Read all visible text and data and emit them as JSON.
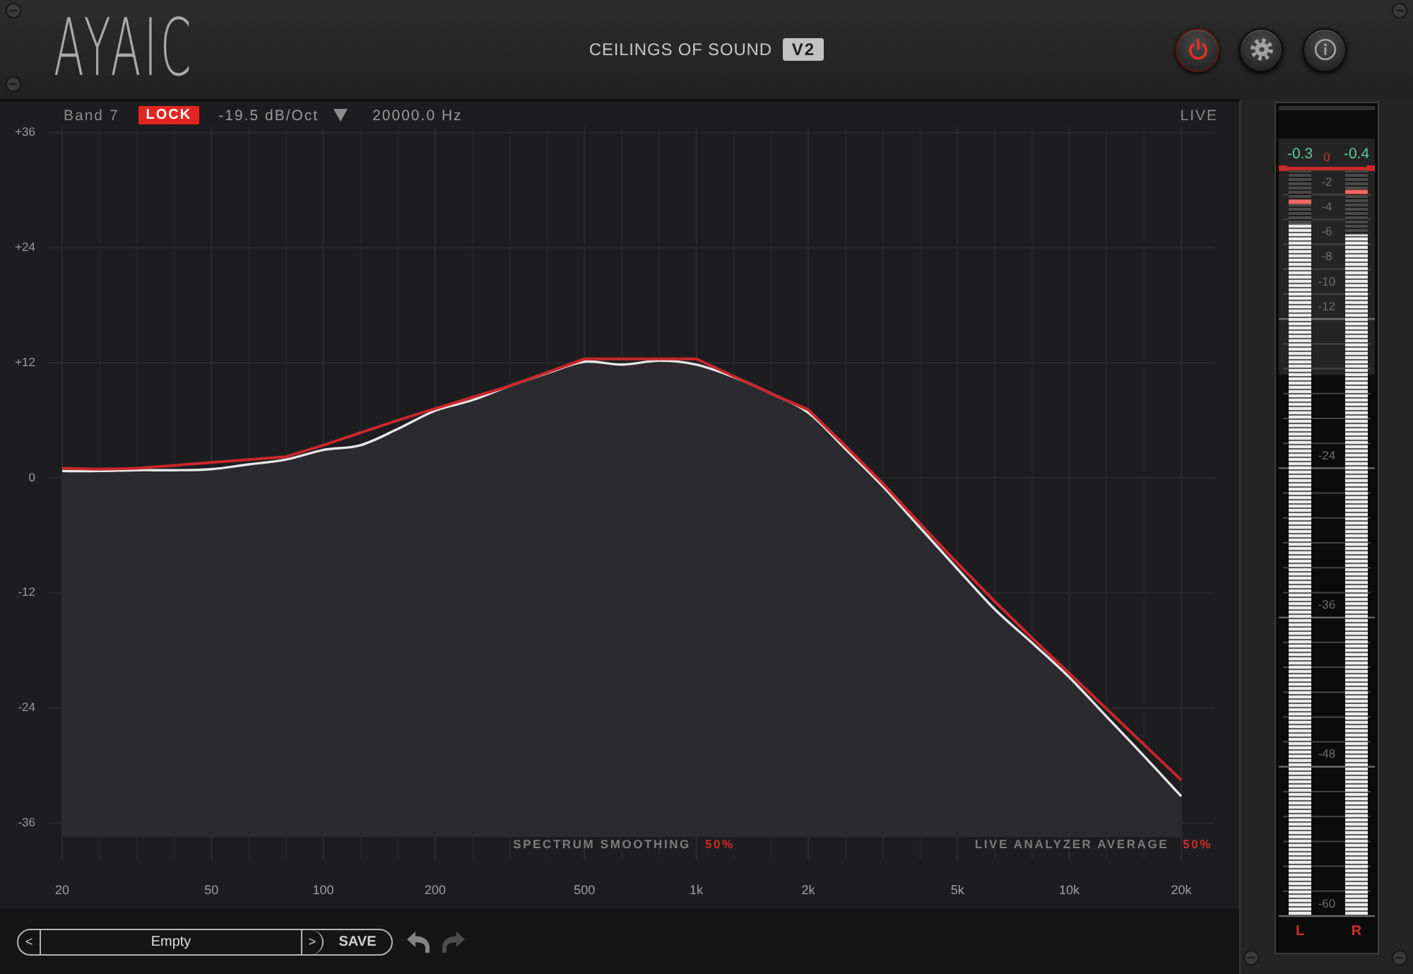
{
  "header": {
    "logo": "AYAIC",
    "title": "CEILINGS OF SOUND",
    "version": "V2",
    "buttons": [
      {
        "kind": "power",
        "on": true
      },
      {
        "kind": "settings",
        "on": false
      },
      {
        "kind": "info",
        "on": false
      }
    ]
  },
  "band_bar": {
    "band": "Band 7",
    "lock": {
      "label": "LOCK",
      "on": true
    },
    "slope": "-19.5 dB/Oct",
    "frequency": "20000.0 Hz",
    "mode": "LIVE"
  },
  "eq_graph": {
    "chart_data": {
      "type": "line",
      "grid": true,
      "categories": [
        "20",
        null,
        null,
        null,
        "50",
        null,
        null,
        "100",
        null,
        null,
        "200",
        null,
        null,
        null,
        "500",
        null,
        null,
        "1k",
        null,
        null,
        "2k",
        null,
        null,
        null,
        "5k",
        null,
        null,
        "10k",
        null,
        null,
        "20k"
      ],
      "series": [
        {
          "type": "area",
          "color": "#e6e6e6",
          "values": [
            0.7,
            0.7,
            0.8,
            0.8,
            0.9,
            1.4,
            1.9,
            2.9,
            3.4,
            5.1,
            7.0,
            8.1,
            9.6,
            10.9,
            12.1,
            11.8,
            12.2,
            11.8,
            10.5,
            8.8,
            6.8,
            3.0,
            -0.9,
            -5.2,
            -9.5,
            -13.7,
            -17.2,
            -20.8,
            -24.9,
            -29.0,
            -33.2
          ]
        },
        {
          "type": "line",
          "color": "#c9262c",
          "values": [
            1.0,
            0.9,
            1.0,
            1.3,
            1.6,
            1.9,
            2.2,
            3.4,
            4.7,
            6.0,
            7.2,
            8.4,
            9.6,
            11.0,
            12.4,
            12.4,
            12.4,
            12.4,
            10.6,
            8.8,
            7.1,
            3.3,
            -0.6,
            -4.8,
            -8.9,
            -12.9,
            -16.7,
            -20.4,
            -24.1,
            -27.8,
            -31.5
          ]
        }
      ],
      "ylim": [
        -36,
        36
      ],
      "yticks": [
        {
          "value": 36,
          "label": "+36"
        },
        {
          "value": 24,
          "label": "+24"
        },
        {
          "value": 12,
          "label": "+12"
        },
        0,
        -12,
        -24,
        -36
      ]
    }
  },
  "analyzer_settings": [
    {
      "label": "SPECTRUM SMOOTHING",
      "value": "50%"
    },
    {
      "label": "LIVE ANALYZER AVERAGE",
      "value": "50%"
    }
  ],
  "preset_bar": {
    "previous": "<",
    "preset": "Empty",
    "next": ">",
    "save": "SAVE",
    "undo": {
      "disabled": false
    },
    "redo": {
      "disabled": true
    }
  },
  "meter": {
    "scale": [
      "0",
      "-2",
      "-4",
      "-6",
      "-8",
      "-10",
      "-12",
      "-24",
      "-36",
      "-48",
      "-60"
    ],
    "channels": [
      {
        "label": "L",
        "reading": "-0.3",
        "level": 0.928,
        "peak_hold": {
          "level": 0.957
        }
      },
      {
        "label": "R",
        "reading": "-0.4",
        "level": 0.913,
        "peak_hold": {
          "level": 0.97
        }
      }
    ]
  }
}
